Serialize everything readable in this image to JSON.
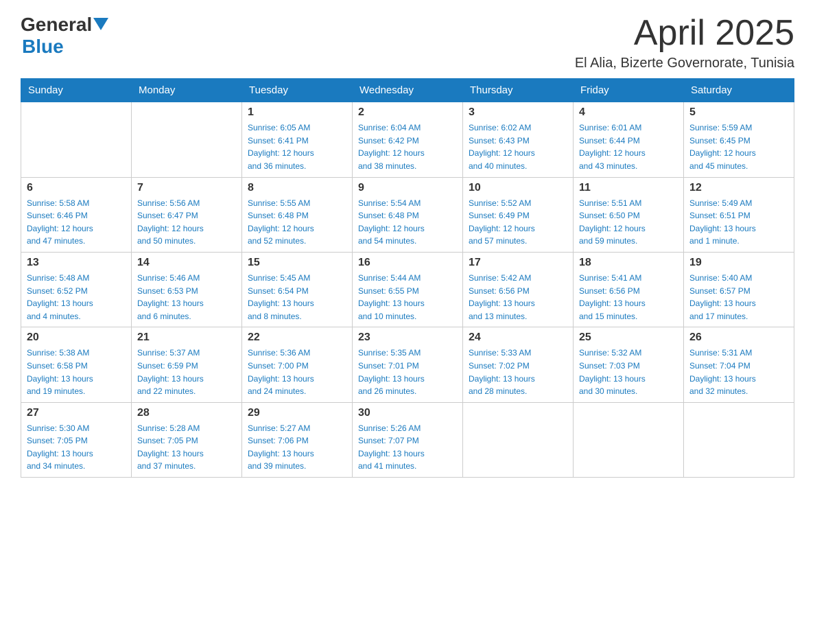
{
  "header": {
    "logo": {
      "general_text": "General",
      "blue_text": "Blue"
    },
    "month_year": "April 2025",
    "location": "El Alia, Bizerte Governorate, Tunisia"
  },
  "calendar": {
    "days_of_week": [
      "Sunday",
      "Monday",
      "Tuesday",
      "Wednesday",
      "Thursday",
      "Friday",
      "Saturday"
    ],
    "weeks": [
      [
        {
          "day": "",
          "info": ""
        },
        {
          "day": "",
          "info": ""
        },
        {
          "day": "1",
          "info": "Sunrise: 6:05 AM\nSunset: 6:41 PM\nDaylight: 12 hours\nand 36 minutes."
        },
        {
          "day": "2",
          "info": "Sunrise: 6:04 AM\nSunset: 6:42 PM\nDaylight: 12 hours\nand 38 minutes."
        },
        {
          "day": "3",
          "info": "Sunrise: 6:02 AM\nSunset: 6:43 PM\nDaylight: 12 hours\nand 40 minutes."
        },
        {
          "day": "4",
          "info": "Sunrise: 6:01 AM\nSunset: 6:44 PM\nDaylight: 12 hours\nand 43 minutes."
        },
        {
          "day": "5",
          "info": "Sunrise: 5:59 AM\nSunset: 6:45 PM\nDaylight: 12 hours\nand 45 minutes."
        }
      ],
      [
        {
          "day": "6",
          "info": "Sunrise: 5:58 AM\nSunset: 6:46 PM\nDaylight: 12 hours\nand 47 minutes."
        },
        {
          "day": "7",
          "info": "Sunrise: 5:56 AM\nSunset: 6:47 PM\nDaylight: 12 hours\nand 50 minutes."
        },
        {
          "day": "8",
          "info": "Sunrise: 5:55 AM\nSunset: 6:48 PM\nDaylight: 12 hours\nand 52 minutes."
        },
        {
          "day": "9",
          "info": "Sunrise: 5:54 AM\nSunset: 6:48 PM\nDaylight: 12 hours\nand 54 minutes."
        },
        {
          "day": "10",
          "info": "Sunrise: 5:52 AM\nSunset: 6:49 PM\nDaylight: 12 hours\nand 57 minutes."
        },
        {
          "day": "11",
          "info": "Sunrise: 5:51 AM\nSunset: 6:50 PM\nDaylight: 12 hours\nand 59 minutes."
        },
        {
          "day": "12",
          "info": "Sunrise: 5:49 AM\nSunset: 6:51 PM\nDaylight: 13 hours\nand 1 minute."
        }
      ],
      [
        {
          "day": "13",
          "info": "Sunrise: 5:48 AM\nSunset: 6:52 PM\nDaylight: 13 hours\nand 4 minutes."
        },
        {
          "day": "14",
          "info": "Sunrise: 5:46 AM\nSunset: 6:53 PM\nDaylight: 13 hours\nand 6 minutes."
        },
        {
          "day": "15",
          "info": "Sunrise: 5:45 AM\nSunset: 6:54 PM\nDaylight: 13 hours\nand 8 minutes."
        },
        {
          "day": "16",
          "info": "Sunrise: 5:44 AM\nSunset: 6:55 PM\nDaylight: 13 hours\nand 10 minutes."
        },
        {
          "day": "17",
          "info": "Sunrise: 5:42 AM\nSunset: 6:56 PM\nDaylight: 13 hours\nand 13 minutes."
        },
        {
          "day": "18",
          "info": "Sunrise: 5:41 AM\nSunset: 6:56 PM\nDaylight: 13 hours\nand 15 minutes."
        },
        {
          "day": "19",
          "info": "Sunrise: 5:40 AM\nSunset: 6:57 PM\nDaylight: 13 hours\nand 17 minutes."
        }
      ],
      [
        {
          "day": "20",
          "info": "Sunrise: 5:38 AM\nSunset: 6:58 PM\nDaylight: 13 hours\nand 19 minutes."
        },
        {
          "day": "21",
          "info": "Sunrise: 5:37 AM\nSunset: 6:59 PM\nDaylight: 13 hours\nand 22 minutes."
        },
        {
          "day": "22",
          "info": "Sunrise: 5:36 AM\nSunset: 7:00 PM\nDaylight: 13 hours\nand 24 minutes."
        },
        {
          "day": "23",
          "info": "Sunrise: 5:35 AM\nSunset: 7:01 PM\nDaylight: 13 hours\nand 26 minutes."
        },
        {
          "day": "24",
          "info": "Sunrise: 5:33 AM\nSunset: 7:02 PM\nDaylight: 13 hours\nand 28 minutes."
        },
        {
          "day": "25",
          "info": "Sunrise: 5:32 AM\nSunset: 7:03 PM\nDaylight: 13 hours\nand 30 minutes."
        },
        {
          "day": "26",
          "info": "Sunrise: 5:31 AM\nSunset: 7:04 PM\nDaylight: 13 hours\nand 32 minutes."
        }
      ],
      [
        {
          "day": "27",
          "info": "Sunrise: 5:30 AM\nSunset: 7:05 PM\nDaylight: 13 hours\nand 34 minutes."
        },
        {
          "day": "28",
          "info": "Sunrise: 5:28 AM\nSunset: 7:05 PM\nDaylight: 13 hours\nand 37 minutes."
        },
        {
          "day": "29",
          "info": "Sunrise: 5:27 AM\nSunset: 7:06 PM\nDaylight: 13 hours\nand 39 minutes."
        },
        {
          "day": "30",
          "info": "Sunrise: 5:26 AM\nSunset: 7:07 PM\nDaylight: 13 hours\nand 41 minutes."
        },
        {
          "day": "",
          "info": ""
        },
        {
          "day": "",
          "info": ""
        },
        {
          "day": "",
          "info": ""
        }
      ]
    ]
  }
}
